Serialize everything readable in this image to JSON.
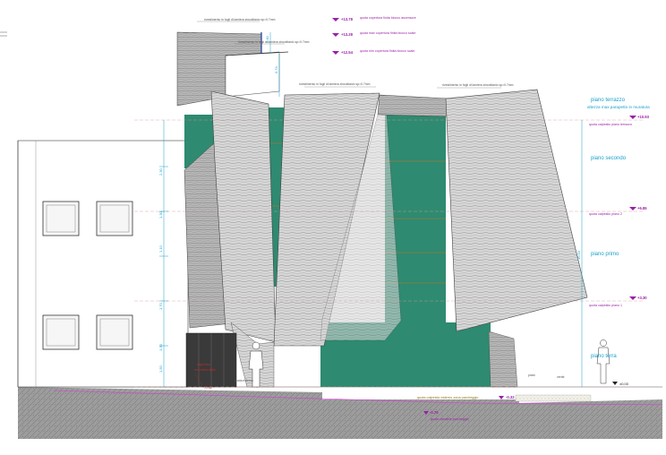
{
  "annotations": {
    "top_note_1": "rivestimento in fogli di lamiera zincotitanio sp=0.7mm",
    "top_note_2": "rivestimento in fogli di lamiera zincotitanio sp=0.7mm",
    "mid_note_1": "rivestimento in fogli di lamiera zincotitanio sp=0.7mm",
    "mid_note_2": "rivestimento in fogli di lamiera zincotitanio sp=0.7mm"
  },
  "levels": {
    "l1_value": "+13.78",
    "l1_label": "quota copertura finita blocco ascensore",
    "l2_value": "+13.28",
    "l2_label": "quota max copertura finita blocco scale",
    "l3_value": "+12.54",
    "l3_label": "quota min copertura finita blocco scale",
    "l4_value": "+10.93",
    "l4_label": "quota calpestio piano terrazzo",
    "l5_value": "+6.85",
    "l5_label": "quota calpestio piano 2",
    "l6_value": "+3.30",
    "l6_label": "quota calpestio piano 1",
    "l7_value": "±0.00",
    "l8_value": "-0.32",
    "l8_label": "quota calpestio esterno zona parcheggio",
    "l9_value": "-0.75",
    "l9_label": "quota carrabile parcheggio",
    "l10_value": "-0.32"
  },
  "floors": {
    "terrazzo": "piano terrazzo",
    "terrazzo_note": "altezza max parapetto in muratura",
    "secondo": "piano secondo",
    "primo": "piano primo",
    "terra": "piano terra"
  },
  "dimensions": {
    "d1": "2.40",
    "d2": "0.74",
    "d3": "2.30",
    "d4": "1.30",
    "d5": "1.10",
    "d6": "1.70",
    "d7": "1.30",
    "d8": "1.50",
    "total": "10.93"
  },
  "entrance": {
    "label_1": "ingresso",
    "label_2": "monumentale",
    "label_3": "quota esterna"
  },
  "ground_labels": {
    "grass": "prato",
    "lawn": "verde"
  }
}
